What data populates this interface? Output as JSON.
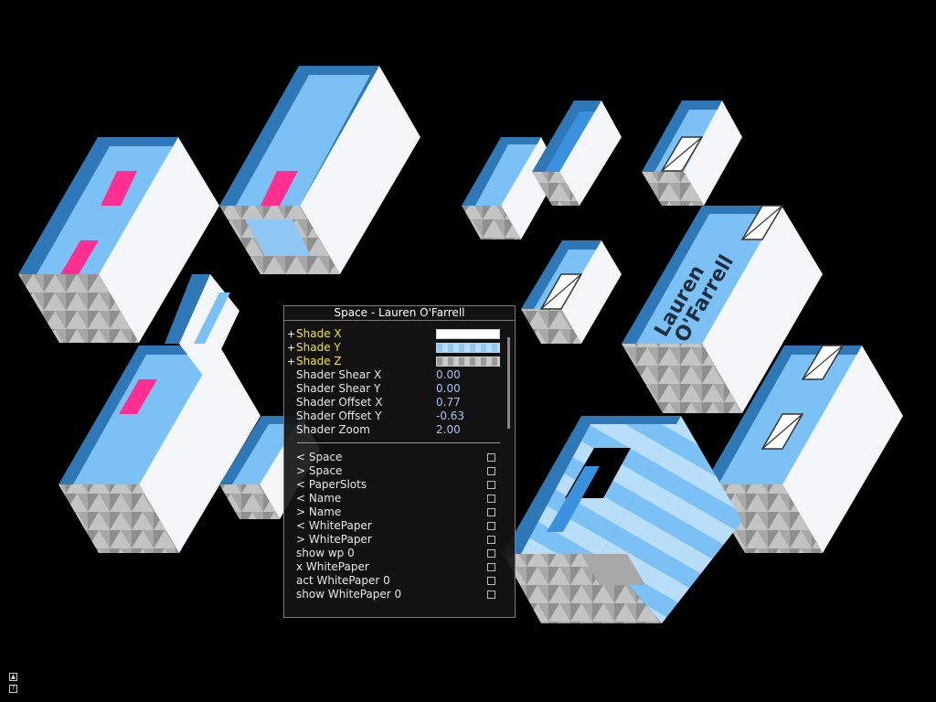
{
  "panel": {
    "title": "Space - Lauren O'Farrell",
    "shades": [
      {
        "label": "Shade X",
        "plus": "+"
      },
      {
        "label": "Shade Y",
        "plus": "+"
      },
      {
        "label": "Shade Z",
        "plus": "+"
      }
    ],
    "params": [
      {
        "label": "Shader Shear X",
        "value": "0.00"
      },
      {
        "label": "Shader Shear Y",
        "value": "0.00"
      },
      {
        "label": "Shader Offset X",
        "value": "0.77"
      },
      {
        "label": "Shader Offset Y",
        "value": "-0.63"
      },
      {
        "label": "Shader Zoom",
        "value": "2.00"
      }
    ],
    "items": [
      "< Space",
      "> Space",
      "< PaperSlots",
      "< Name",
      "> Name",
      "< WhitePaper",
      "> WhitePaper",
      "show wp 0",
      "x WhitePaper",
      "act WhitePaper 0",
      "show WhitePaper 0"
    ]
  },
  "scene": {
    "name_text_1": "Lauren",
    "name_text_2": "O'Farrell",
    "colors": {
      "dark_blue": "#2f78b8",
      "mid_blue": "#7cc1f6",
      "light_face": "#f4f6f8",
      "gray": "#9c9c9c",
      "pink": "#ff2f92"
    }
  },
  "corner_icons": [
    "up-arrow-icon",
    "help-icon"
  ]
}
